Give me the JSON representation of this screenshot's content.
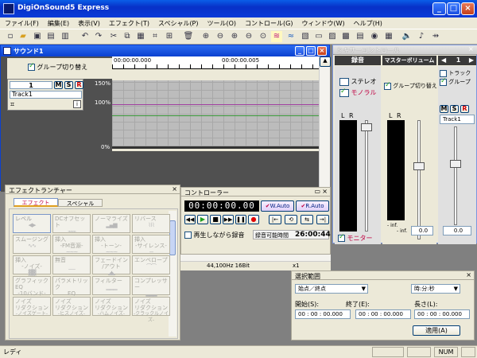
{
  "app": {
    "title": "DigiOnSound5 Express"
  },
  "menu": [
    "ファイル(F)",
    "編集(E)",
    "表示(V)",
    "エフェクト(T)",
    "スペシャル(P)",
    "ツール(O)",
    "コントロール(G)",
    "ウィンドウ(W)",
    "ヘルプ(H)"
  ],
  "sound_window": {
    "title": "サウンド1",
    "group_toggle": "グループ切り替え",
    "track_number": "1",
    "track_buttons": [
      "M",
      "S",
      "R"
    ],
    "track_name": "Track1",
    "time_start": "00:00:00.000",
    "time_mark": "00:00:00.005",
    "levels": [
      "150%",
      "100%",
      "0%"
    ],
    "info_rate": "44,100Hz 16Bit",
    "info_zoom": "x1"
  },
  "mixer": {
    "title": "ミキサーコントロール",
    "col_record": "録音",
    "col_master": "マスターボリューム",
    "col_track": "1",
    "stereo": "ステレオ",
    "mono": "モノラル",
    "group_toggle": "グループ切り替え",
    "track_label": "トラック",
    "group_label": "グループ",
    "lr": [
      "L",
      "R"
    ],
    "inf": [
      "- inf.",
      "- inf."
    ],
    "value_master": "0.0",
    "value_track": "0.0",
    "monitor": "モニター",
    "track_buttons": [
      "M",
      "S",
      "R"
    ],
    "track_name": "Track1"
  },
  "effects": {
    "title": "エフェクトランチャー",
    "tabs": [
      "エフェクト",
      "スペシャル"
    ],
    "buttons": [
      {
        "label": "レベル"
      },
      {
        "label": "DCオフセット"
      },
      {
        "label": "ノーマライズ"
      },
      {
        "label": "リバース"
      },
      {
        "label": "スムージング"
      },
      {
        "label": "挿入",
        "sub": "-FM音源-"
      },
      {
        "label": "挿入",
        "sub": "-トーン-"
      },
      {
        "label": "挿入",
        "sub": "-サイレンス-"
      },
      {
        "label": "挿入",
        "sub": "-ノイズ-"
      },
      {
        "label": "無音"
      },
      {
        "label": "フェードイン",
        "sub": "/アウト"
      },
      {
        "label": "エンベロープ"
      },
      {
        "label": "グラフィックEQ",
        "sub": "-10バンド-"
      },
      {
        "label": "パラメトリック",
        "sub": "EQ"
      },
      {
        "label": "フィルター"
      },
      {
        "label": "コンプレッサー"
      },
      {
        "label": "ノイズ",
        "sub": "リダクション",
        "sub2": "-ノイズゲート-"
      },
      {
        "label": "ノイズ",
        "sub": "リダクション",
        "sub2": "-ヒスノイズ-"
      },
      {
        "label": "ノイズ",
        "sub": "リダクション",
        "sub2": "-ハムノイズ-"
      },
      {
        "label": "ノイズ",
        "sub": "リダクション",
        "sub2": "-クラックルノイズ-"
      }
    ]
  },
  "controller": {
    "title": "コントローラー",
    "time": "00:00:00.00",
    "w_auto": "W.Auto",
    "r_auto": "R.Auto",
    "play_rec": "再生しながら録音",
    "rec_time_label": "録音可能時間",
    "rec_time": "26:00:44"
  },
  "selection": {
    "title": "選択範囲",
    "mode": "始点／終点",
    "format": "時:分:秒",
    "start_label": "開始(S):",
    "end_label": "終了(E):",
    "length_label": "長さ(L):",
    "start": "00 : 00 : 00.000",
    "end": "00 : 00 : 00.000",
    "length": "00 : 00 : 00.000",
    "apply": "適用(A)"
  },
  "status": {
    "text": "レディ",
    "num": "NUM"
  }
}
